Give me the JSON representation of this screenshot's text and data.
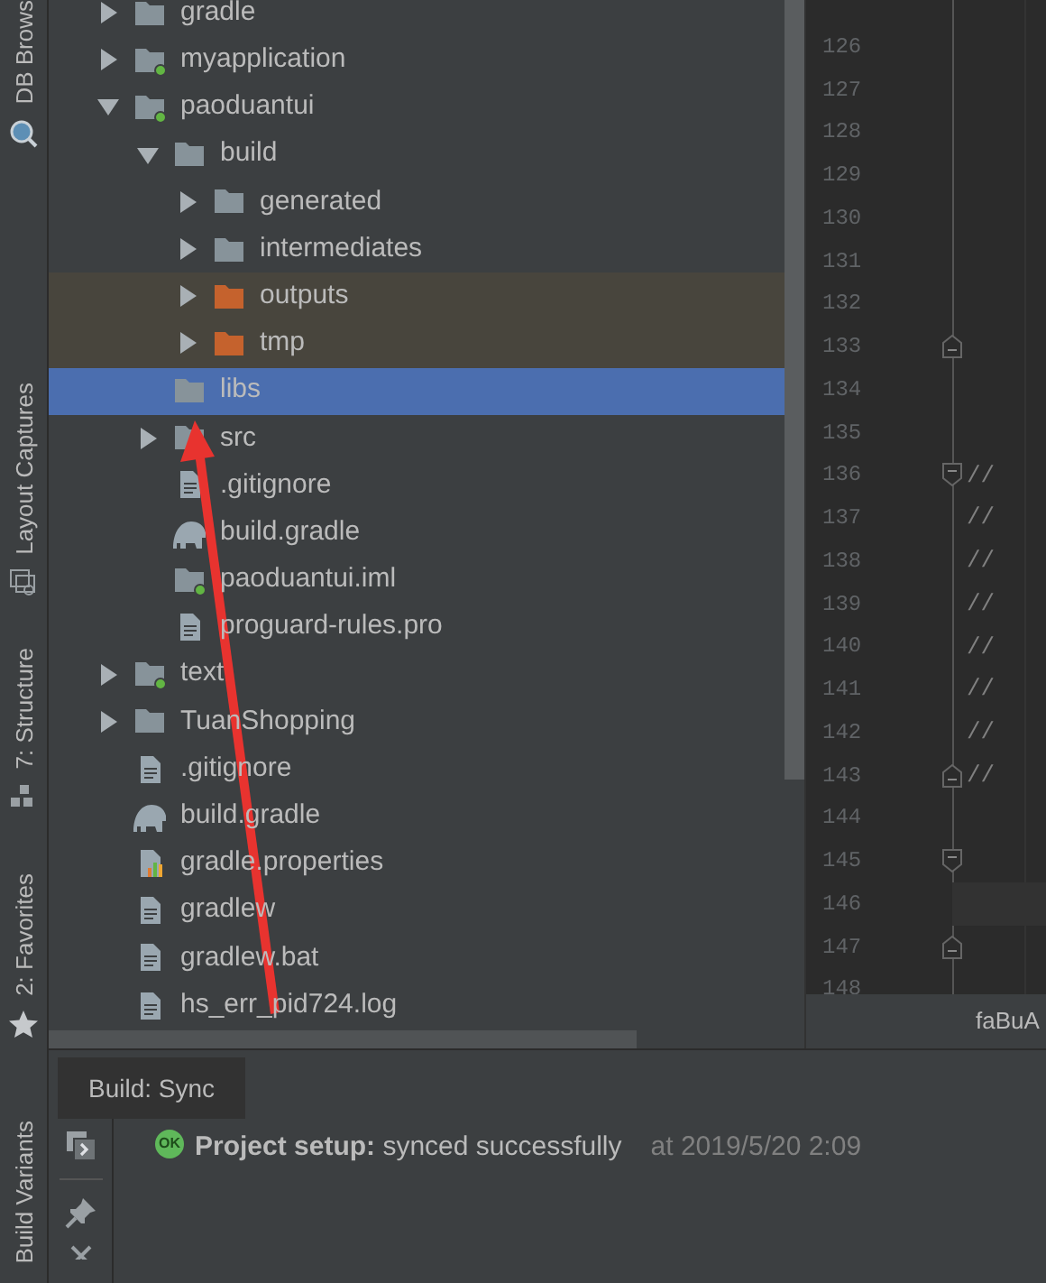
{
  "tool_strip": [
    {
      "label": "DB Brows"
    },
    {
      "label": "Layout Captures"
    },
    {
      "label": "7: Structure"
    },
    {
      "label": "2: Favorites"
    }
  ],
  "bottom_tool_strip": [
    {
      "label": "Build Variants"
    }
  ],
  "tree": [
    {
      "label": "gradle",
      "kind": "folder",
      "expanded": false,
      "selected": false
    },
    {
      "label": "myapplication",
      "kind": "module",
      "expanded": false,
      "selected": false
    },
    {
      "label": "paoduantui",
      "kind": "module",
      "expanded": true,
      "selected": false,
      "children": [
        {
          "label": "build",
          "kind": "folder",
          "expanded": true,
          "selected": false,
          "children": [
            {
              "label": "generated",
              "kind": "folder",
              "expanded": false,
              "selected": false
            },
            {
              "label": "intermediates",
              "kind": "folder",
              "expanded": false,
              "selected": false
            },
            {
              "label": "outputs",
              "kind": "excluded",
              "expanded": false,
              "selected": false
            },
            {
              "label": "tmp",
              "kind": "excluded",
              "expanded": false,
              "selected": false
            }
          ]
        },
        {
          "label": "libs",
          "kind": "folder",
          "selected": true
        },
        {
          "label": "src",
          "kind": "folder",
          "expanded": false,
          "selected": false
        },
        {
          "label": ".gitignore",
          "kind": "file",
          "selected": false
        },
        {
          "label": "build.gradle",
          "kind": "gradle",
          "selected": false
        },
        {
          "label": "paoduantui.iml",
          "kind": "iml",
          "selected": false
        },
        {
          "label": "proguard-rules.pro",
          "kind": "file",
          "selected": false
        }
      ]
    },
    {
      "label": "text",
      "kind": "module",
      "expanded": false,
      "selected": false
    },
    {
      "label": "TuanShopping",
      "kind": "folder",
      "expanded": false,
      "selected": false
    },
    {
      "label": ".gitignore",
      "kind": "file",
      "selected": false
    },
    {
      "label": "build.gradle",
      "kind": "gradle",
      "selected": false
    },
    {
      "label": "gradle.properties",
      "kind": "properties",
      "selected": false
    },
    {
      "label": "gradlew",
      "kind": "file",
      "selected": false
    },
    {
      "label": "gradlew.bat",
      "kind": "file",
      "selected": false
    },
    {
      "label": "hs_err_pid724.log",
      "kind": "file",
      "selected": false
    }
  ],
  "editor": {
    "lines": [
      {
        "number": "126",
        "kind": "plain",
        "current": false
      },
      {
        "number": "127",
        "kind": "plain",
        "current": false
      },
      {
        "number": "128",
        "kind": "plain",
        "current": false
      },
      {
        "number": "129",
        "kind": "plain",
        "current": false
      },
      {
        "number": "130",
        "kind": "plain",
        "current": false
      },
      {
        "number": "131",
        "kind": "plain",
        "current": false
      },
      {
        "number": "132",
        "kind": "plain",
        "current": false
      },
      {
        "number": "133",
        "kind": "fold-end",
        "current": false
      },
      {
        "number": "134",
        "kind": "plain",
        "current": false
      },
      {
        "number": "135",
        "kind": "plain",
        "current": false
      },
      {
        "number": "136",
        "kind": "fold-start",
        "code": "//",
        "current": false
      },
      {
        "number": "137",
        "kind": "plain",
        "code": "//",
        "current": false
      },
      {
        "number": "138",
        "kind": "plain",
        "code": "//",
        "current": false
      },
      {
        "number": "139",
        "kind": "plain",
        "code": "//",
        "current": false
      },
      {
        "number": "140",
        "kind": "plain",
        "code": "//",
        "current": false
      },
      {
        "number": "141",
        "kind": "plain",
        "code": "//",
        "current": false
      },
      {
        "number": "142",
        "kind": "plain",
        "code": "//",
        "current": false
      },
      {
        "number": "143",
        "kind": "fold-end",
        "code": "//",
        "current": false
      },
      {
        "number": "144",
        "kind": "plain",
        "current": false
      },
      {
        "number": "145",
        "kind": "fold-start",
        "current": false
      },
      {
        "number": "146",
        "kind": "plain",
        "current": true
      },
      {
        "number": "147",
        "kind": "fold-end",
        "current": false
      },
      {
        "number": "148",
        "kind": "plain",
        "current": false
      }
    ],
    "tab": "faBuA"
  },
  "build_panel": {
    "tabs": [
      {
        "label": "Build: Sync",
        "selected": true
      }
    ],
    "message": {
      "badge": "OK",
      "text": "**Project setup:** synced successfully",
      "time": "at 2019/5/20 2:09"
    }
  }
}
